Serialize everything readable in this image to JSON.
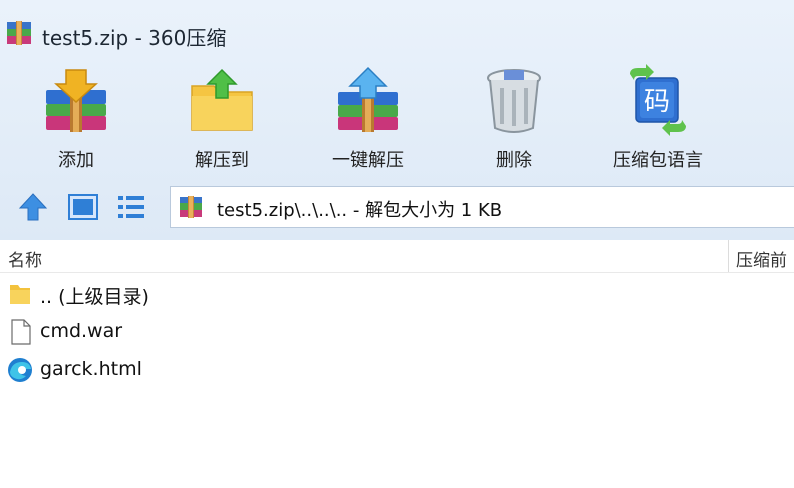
{
  "window": {
    "title": "test5.zip - 360压缩"
  },
  "toolbar": {
    "items": [
      {
        "label": "添加",
        "icon": "add-archive-icon"
      },
      {
        "label": "解压到",
        "icon": "extract-to-folder-icon"
      },
      {
        "label": "一键解压",
        "icon": "one-click-extract-icon"
      },
      {
        "label": "删除",
        "icon": "trash-bin-icon"
      },
      {
        "label": "压缩包语言",
        "icon": "archive-language-icon"
      }
    ]
  },
  "nav": {
    "icons": [
      "up-arrow-icon",
      "view-large-icon",
      "view-list-icon"
    ],
    "address": "test5.zip\\..\\..\\.. - 解包大小为 1 KB"
  },
  "list": {
    "columns": {
      "name": "名称",
      "compressed_before": "压缩前"
    },
    "rows": [
      {
        "name": ".. (上级目录)",
        "icon": "parent-folder-icon"
      },
      {
        "name": "cmd.war",
        "icon": "file-icon"
      },
      {
        "name": "garck.html",
        "icon": "edge-html-icon"
      }
    ]
  },
  "colors": {
    "chrome_bg": "#dde9f6",
    "accent_blue": "#2f7fd6"
  }
}
